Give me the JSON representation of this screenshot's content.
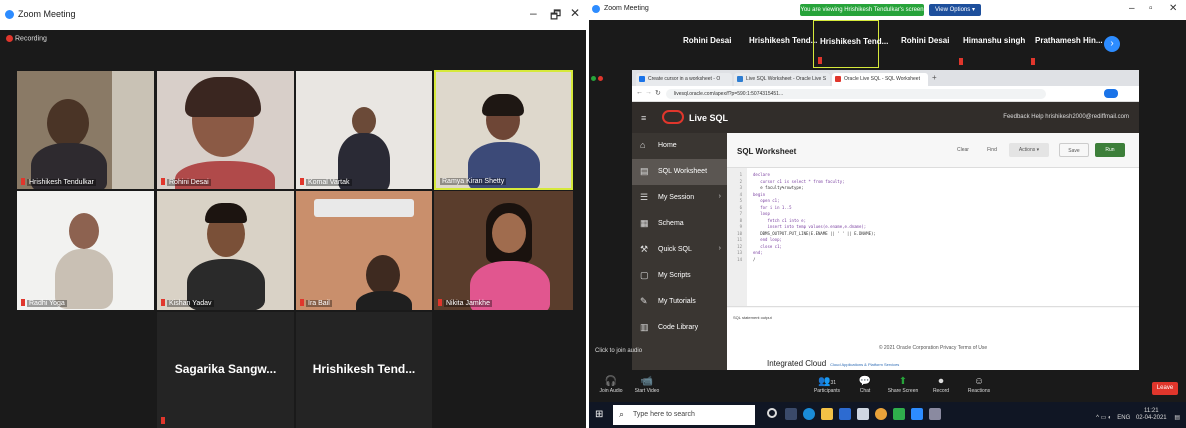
{
  "left_window": {
    "title": "Zoom Meeting",
    "recording_label": "Recording",
    "participants": [
      {
        "name": "Hrishikesh Tendulkar"
      },
      {
        "name": "Rohini Desai"
      },
      {
        "name": "Komal Vartak"
      },
      {
        "name": "Ramya Kiran Shetty"
      },
      {
        "name": "Radhi Yoga"
      },
      {
        "name": "Kishan Yadav"
      },
      {
        "name": "Ira Bail"
      },
      {
        "name": "Nikita Jamkhe"
      },
      {
        "name": "Sagarika Sangw..."
      },
      {
        "name": "Hrishikesh Tend..."
      }
    ],
    "window_controls": [
      "–",
      "🗗",
      "✕"
    ]
  },
  "right_window": {
    "title": "Zoom Meeting",
    "share_banner": "You are viewing Hrishikesh Tendulkar's screen",
    "view_options": "View Options ▾",
    "top_strip": [
      "Rohini Desai",
      "Hrishikesh Tend...",
      "Hrishikesh Tend...",
      "Rohini Desai",
      "Himanshu singh",
      "Prathamesh Hin..."
    ],
    "browser": {
      "tabs": [
        "Create cursor in a worksheet - O",
        "Live SQL Worksheet - Oracle Live S",
        "Oracle Live SQL - SQL Worksheet"
      ],
      "address": "livesql.oracle.com/apex/f?p=590:1:5074315451..."
    },
    "oracle": {
      "brand": "Live SQL",
      "header_links": "Feedback   Help   hrishikesh2000@rediffmail.com",
      "sidebar": [
        {
          "label": "Home",
          "icon": "⌂"
        },
        {
          "label": "SQL Worksheet",
          "icon": "▤"
        },
        {
          "label": "My Session",
          "icon": "☰"
        },
        {
          "label": "Schema",
          "icon": "▦"
        },
        {
          "label": "Quick SQL",
          "icon": "⚒"
        },
        {
          "label": "My Scripts",
          "icon": "▢"
        },
        {
          "label": "My Tutorials",
          "icon": "✎"
        },
        {
          "label": "Code Library",
          "icon": "▥"
        }
      ],
      "worksheet_title": "SQL Worksheet",
      "buttons": {
        "clear": "Clear",
        "find": "Find",
        "actions": "Actions ▾",
        "save": "Save",
        "run": "Run"
      },
      "code": [
        {
          "ln": "1",
          "text": "declare"
        },
        {
          "ln": "2",
          "text": "   cursor c1 is select * from faculty;"
        },
        {
          "ln": "3",
          "text": "   e faculty%rowtype;"
        },
        {
          "ln": "4",
          "text": "begin"
        },
        {
          "ln": "5",
          "text": "   open c1;"
        },
        {
          "ln": "6",
          "text": "   for i in 1..5"
        },
        {
          "ln": "7",
          "text": "   loop"
        },
        {
          "ln": "8",
          "text": "      fetch c1 into e;"
        },
        {
          "ln": "9",
          "text": "      insert into temp values(e.ename,e.dname);"
        },
        {
          "ln": "10",
          "text": "   DBMS_OUTPUT.PUT_LINE(E.ENAME || ' ' || E.DNAME);"
        },
        {
          "ln": "11",
          "text": "   end loop;"
        },
        {
          "ln": "12",
          "text": "   close c1;"
        },
        {
          "ln": "13",
          "text": "end;"
        },
        {
          "ln": "14",
          "text": "/"
        }
      ],
      "output_text": "SQL statement output",
      "footer_copyright": "© 2021 Oracle Corporation  Privacy  Terms of Use",
      "footer_brand": "Integrated Cloud",
      "footer_small": "Cloud Applications & Platform Services"
    },
    "join_audio": "Click to join audio",
    "controls": [
      {
        "label": "Join Audio",
        "icon": "🎧"
      },
      {
        "label": "Start Video",
        "icon": "📹"
      },
      {
        "label": "Participants",
        "icon": "👥",
        "count": "31"
      },
      {
        "label": "Chat",
        "icon": "💬"
      },
      {
        "label": "Share Screen",
        "icon": "⬆"
      },
      {
        "label": "Record",
        "icon": "⏺"
      },
      {
        "label": "Reactions",
        "icon": "☺"
      }
    ],
    "leave": "Leave",
    "taskbar": {
      "search_placeholder": "Type here to search",
      "time": "11:21",
      "date": "02-04-2021",
      "lang": "ENG"
    }
  }
}
